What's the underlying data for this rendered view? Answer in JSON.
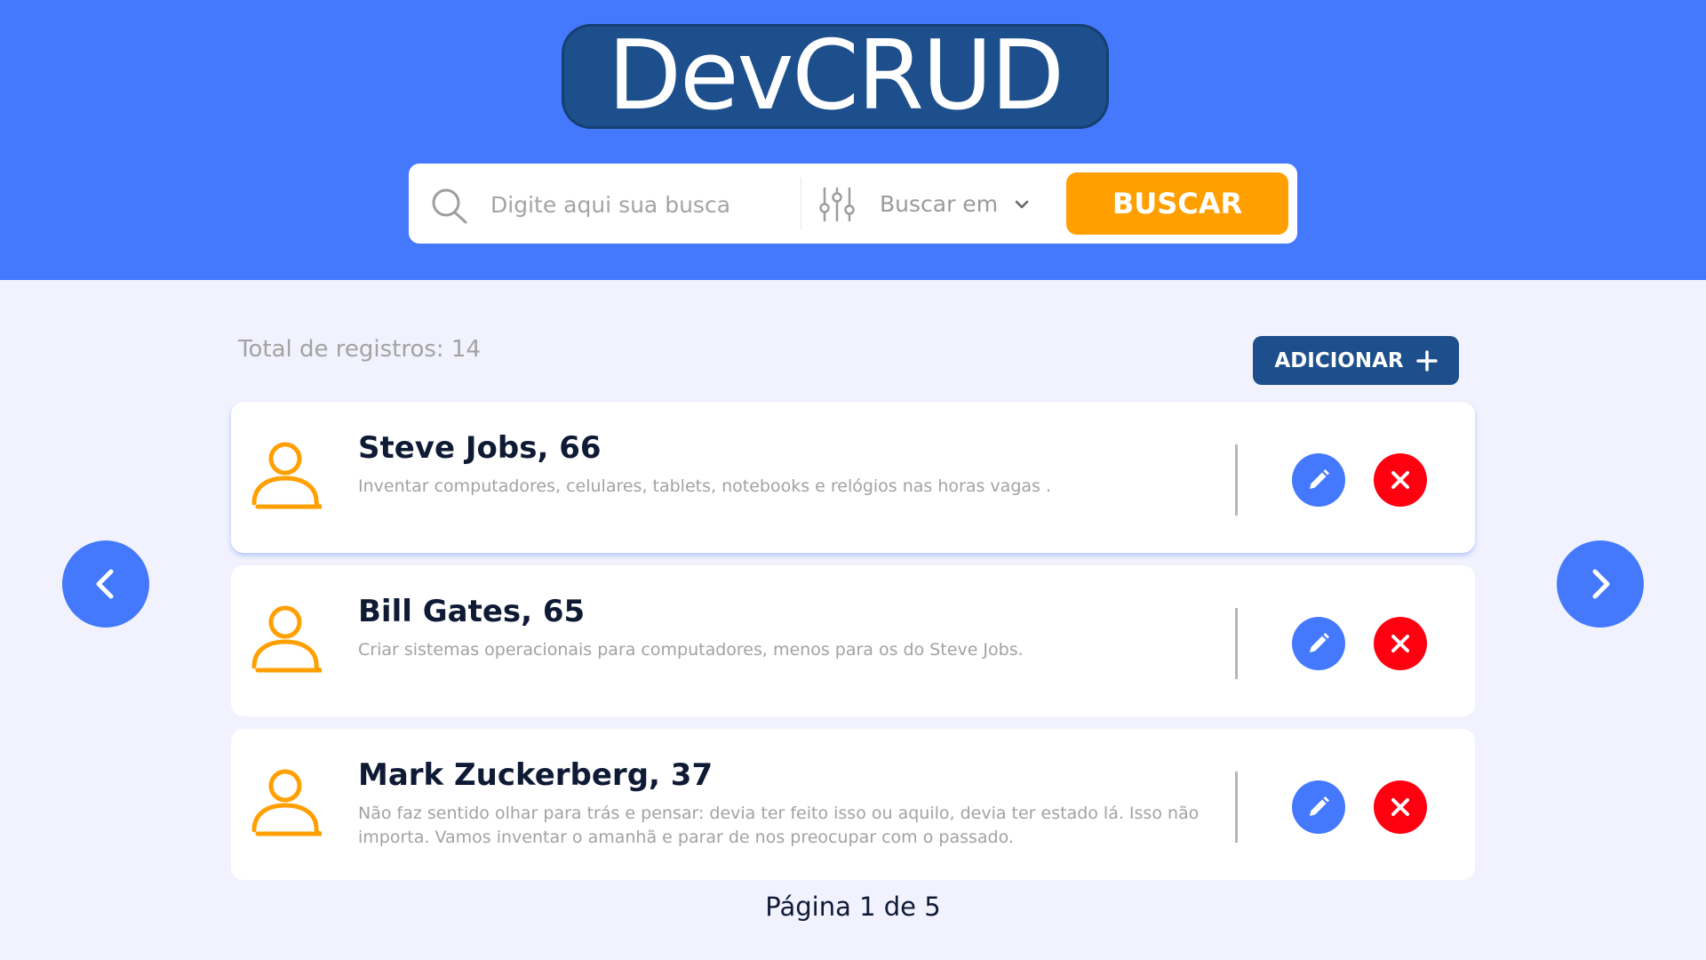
{
  "app": {
    "logo_text": "DevCRUD"
  },
  "search": {
    "placeholder": "Digite aqui sua busca",
    "filter_label": "Buscar em",
    "button_label": "BUSCAR"
  },
  "records": {
    "total_label": "Total de registros: 14",
    "add_label": "ADICIONAR",
    "items": [
      {
        "name": "Steve Jobs, 66",
        "description": "Inventar computadores, celulares, tablets, notebooks e relógios nas horas vagas ."
      },
      {
        "name": "Bill Gates, 65",
        "description": "Criar sistemas operacionais para computadores, menos para os do Steve Jobs."
      },
      {
        "name": "Mark Zuckerberg, 37",
        "description": "Não faz sentido olhar para trás e pensar: devia ter feito isso ou aquilo, devia ter estado lá. Isso não importa. Vamos inventar o amanhã e parar de nos preocupar com o passado."
      }
    ]
  },
  "pagination": {
    "label": "Página 1 de 5"
  },
  "icons": {
    "search": "search-icon",
    "filter": "sliders-icon",
    "chevron": "chevron-down-icon",
    "add": "plus-icon",
    "user": "user-icon",
    "edit": "pencil-icon",
    "delete": "close-icon",
    "prev": "chevron-left-icon",
    "next": "chevron-right-icon"
  },
  "colors": {
    "header_bg": "#4479fd",
    "page_bg": "#f1f2fd",
    "logo_bg": "#1d4f8c",
    "accent_orange": "#ff9f00",
    "edit_blue": "#4479fd",
    "delete_red": "#ff0010",
    "add_button": "#1d4f8c"
  }
}
